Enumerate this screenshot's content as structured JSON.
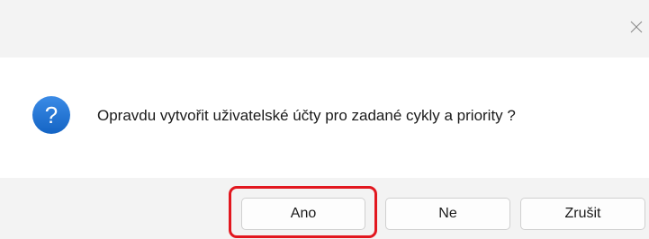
{
  "dialog": {
    "message": "Opravdu vytvořit uživatelské účty pro zadané cykly a priority ?",
    "icon": "question-icon",
    "icon_glyph": "?",
    "icon_color": "#1e6fd0",
    "close_icon": "close-icon"
  },
  "buttons": {
    "yes_label": "Ano",
    "no_label": "Ne",
    "cancel_label": "Zrušit"
  },
  "annotation": {
    "highlight_color": "#e2171f",
    "highlighted_button": "Ano"
  }
}
